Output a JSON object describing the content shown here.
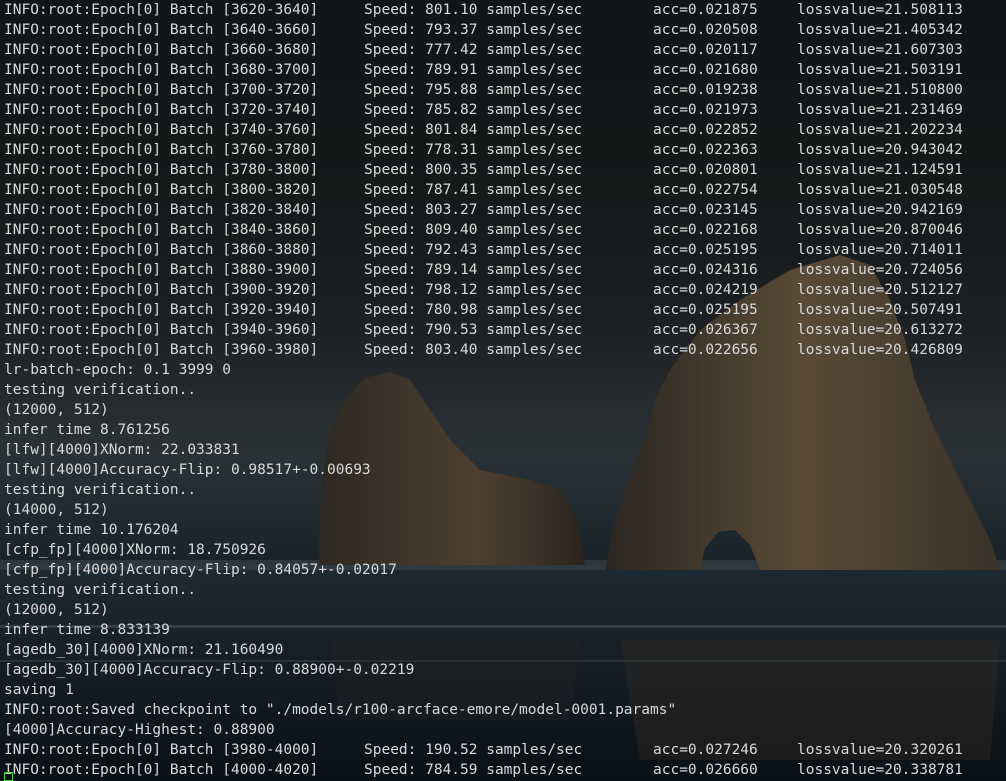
{
  "terminal": {
    "batch_lines_top": [
      {
        "prefix": "INFO:root:Epoch[0] Batch [3620-3640]",
        "speed": "Speed: 801.10 samples/sec",
        "acc": "acc=0.021875",
        "loss": "lossvalue=21.508113"
      },
      {
        "prefix": "INFO:root:Epoch[0] Batch [3640-3660]",
        "speed": "Speed: 793.37 samples/sec",
        "acc": "acc=0.020508",
        "loss": "lossvalue=21.405342"
      },
      {
        "prefix": "INFO:root:Epoch[0] Batch [3660-3680]",
        "speed": "Speed: 777.42 samples/sec",
        "acc": "acc=0.020117",
        "loss": "lossvalue=21.607303"
      },
      {
        "prefix": "INFO:root:Epoch[0] Batch [3680-3700]",
        "speed": "Speed: 789.91 samples/sec",
        "acc": "acc=0.021680",
        "loss": "lossvalue=21.503191"
      },
      {
        "prefix": "INFO:root:Epoch[0] Batch [3700-3720]",
        "speed": "Speed: 795.88 samples/sec",
        "acc": "acc=0.019238",
        "loss": "lossvalue=21.510800"
      },
      {
        "prefix": "INFO:root:Epoch[0] Batch [3720-3740]",
        "speed": "Speed: 785.82 samples/sec",
        "acc": "acc=0.021973",
        "loss": "lossvalue=21.231469"
      },
      {
        "prefix": "INFO:root:Epoch[0] Batch [3740-3760]",
        "speed": "Speed: 801.84 samples/sec",
        "acc": "acc=0.022852",
        "loss": "lossvalue=21.202234"
      },
      {
        "prefix": "INFO:root:Epoch[0] Batch [3760-3780]",
        "speed": "Speed: 778.31 samples/sec",
        "acc": "acc=0.022363",
        "loss": "lossvalue=20.943042"
      },
      {
        "prefix": "INFO:root:Epoch[0] Batch [3780-3800]",
        "speed": "Speed: 800.35 samples/sec",
        "acc": "acc=0.020801",
        "loss": "lossvalue=21.124591"
      },
      {
        "prefix": "INFO:root:Epoch[0] Batch [3800-3820]",
        "speed": "Speed: 787.41 samples/sec",
        "acc": "acc=0.022754",
        "loss": "lossvalue=21.030548"
      },
      {
        "prefix": "INFO:root:Epoch[0] Batch [3820-3840]",
        "speed": "Speed: 803.27 samples/sec",
        "acc": "acc=0.023145",
        "loss": "lossvalue=20.942169"
      },
      {
        "prefix": "INFO:root:Epoch[0] Batch [3840-3860]",
        "speed": "Speed: 809.40 samples/sec",
        "acc": "acc=0.022168",
        "loss": "lossvalue=20.870046"
      },
      {
        "prefix": "INFO:root:Epoch[0] Batch [3860-3880]",
        "speed": "Speed: 792.43 samples/sec",
        "acc": "acc=0.025195",
        "loss": "lossvalue=20.714011"
      },
      {
        "prefix": "INFO:root:Epoch[0] Batch [3880-3900]",
        "speed": "Speed: 789.14 samples/sec",
        "acc": "acc=0.024316",
        "loss": "lossvalue=20.724056"
      },
      {
        "prefix": "INFO:root:Epoch[0] Batch [3900-3920]",
        "speed": "Speed: 798.12 samples/sec",
        "acc": "acc=0.024219",
        "loss": "lossvalue=20.512127"
      },
      {
        "prefix": "INFO:root:Epoch[0] Batch [3920-3940]",
        "speed": "Speed: 780.98 samples/sec",
        "acc": "acc=0.025195",
        "loss": "lossvalue=20.507491"
      },
      {
        "prefix": "INFO:root:Epoch[0] Batch [3940-3960]",
        "speed": "Speed: 790.53 samples/sec",
        "acc": "acc=0.026367",
        "loss": "lossvalue=20.613272"
      },
      {
        "prefix": "INFO:root:Epoch[0] Batch [3960-3980]",
        "speed": "Speed: 803.40 samples/sec",
        "acc": "acc=0.022656",
        "loss": "lossvalue=20.426809"
      }
    ],
    "plain_lines": [
      "lr-batch-epoch: 0.1 3999 0",
      "testing verification..",
      "(12000, 512)",
      "infer time 8.761256",
      "[lfw][4000]XNorm: 22.033831",
      "[lfw][4000]Accuracy-Flip: 0.98517+-0.00693",
      "testing verification..",
      "(14000, 512)",
      "infer time 10.176204",
      "[cfp_fp][4000]XNorm: 18.750926",
      "[cfp_fp][4000]Accuracy-Flip: 0.84057+-0.02017",
      "testing verification..",
      "(12000, 512)",
      "infer time 8.833139",
      "[agedb_30][4000]XNorm: 21.160490",
      "[agedb_30][4000]Accuracy-Flip: 0.88900+-0.02219",
      "saving 1",
      "INFO:root:Saved checkpoint to \"./models/r100-arcface-emore/model-0001.params\"",
      "[4000]Accuracy-Highest: 0.88900"
    ],
    "batch_lines_bottom": [
      {
        "prefix": "INFO:root:Epoch[0] Batch [3980-4000]",
        "speed": "Speed: 190.52 samples/sec",
        "acc": "acc=0.027246",
        "loss": "lossvalue=20.320261"
      },
      {
        "prefix": "INFO:root:Epoch[0] Batch [4000-4020]",
        "speed": "Speed: 784.59 samples/sec",
        "acc": "acc=0.026660",
        "loss": "lossvalue=20.338781"
      }
    ],
    "text_color": "#d8d8d8",
    "cursor_color": "#3bd13b"
  }
}
